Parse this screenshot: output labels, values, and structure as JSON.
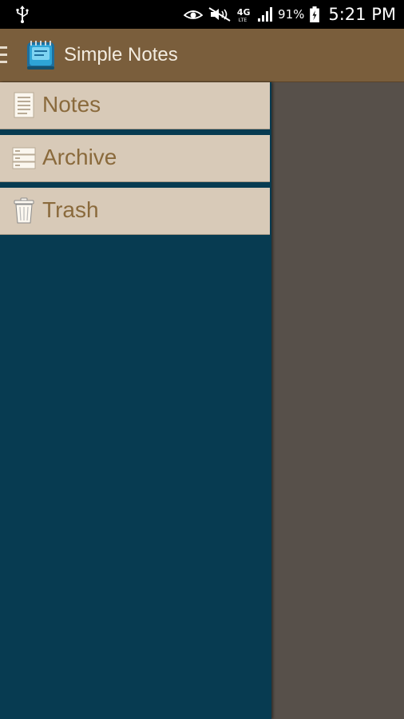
{
  "status_bar": {
    "battery_percent": "91%",
    "time": "5:21 PM",
    "network": "4G",
    "icons": [
      "usb-icon",
      "eye-icon",
      "mute-icon",
      "lte-icon",
      "signal-icon",
      "battery-charging-icon"
    ]
  },
  "action_bar": {
    "title": "Simple Notes",
    "menu_icon": "hamburger-icon",
    "app_icon": "notebook-icon"
  },
  "drawer": {
    "items": [
      {
        "label": "Notes",
        "icon": "document-icon"
      },
      {
        "label": "Archive",
        "icon": "archive-icon"
      },
      {
        "label": "Trash",
        "icon": "trash-icon"
      }
    ]
  },
  "colors": {
    "action_bar": "#7a5e3c",
    "drawer_background": "#073b51",
    "drawer_item": "#d8cab8",
    "drawer_text": "#8a6a3c",
    "dim_overlay": "#57504a"
  }
}
